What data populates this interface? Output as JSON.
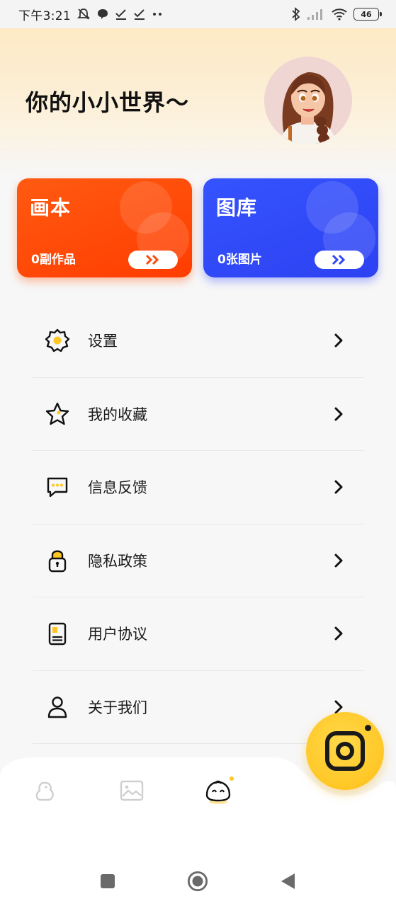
{
  "status_bar": {
    "time": "下午3:21",
    "battery": "46",
    "icons": [
      "mute-icon",
      "chat-bubble-icon",
      "check-icon",
      "check-icon",
      "more-dots-icon",
      "bluetooth-icon",
      "signal-icon",
      "wifi-icon",
      "battery-icon"
    ]
  },
  "header": {
    "title": "你的小小世界～",
    "avatar": "girl-avatar"
  },
  "cards": [
    {
      "title": "画本",
      "count": "0副作品",
      "color": "#ff4a0a",
      "arrow_icon": "double-chevron-right-icon"
    },
    {
      "title": "图库",
      "count": "0张图片",
      "color": "#3148f7",
      "arrow_icon": "double-chevron-right-icon"
    }
  ],
  "menu": [
    {
      "label": "设置",
      "icon": "gear-icon"
    },
    {
      "label": "我的收藏",
      "icon": "star-icon"
    },
    {
      "label": "信息反馈",
      "icon": "message-icon"
    },
    {
      "label": "隐私政策",
      "icon": "lock-icon"
    },
    {
      "label": "用户协议",
      "icon": "document-icon"
    },
    {
      "label": "关于我们",
      "icon": "user-icon"
    }
  ],
  "bottom_nav": {
    "tabs": [
      "creature-icon",
      "image-icon",
      "bun-face-icon"
    ],
    "active": 2,
    "fab": "camera-icon",
    "accent": "#ffc726"
  },
  "system_nav": [
    "square-icon",
    "circle-home-icon",
    "back-triangle-icon"
  ]
}
